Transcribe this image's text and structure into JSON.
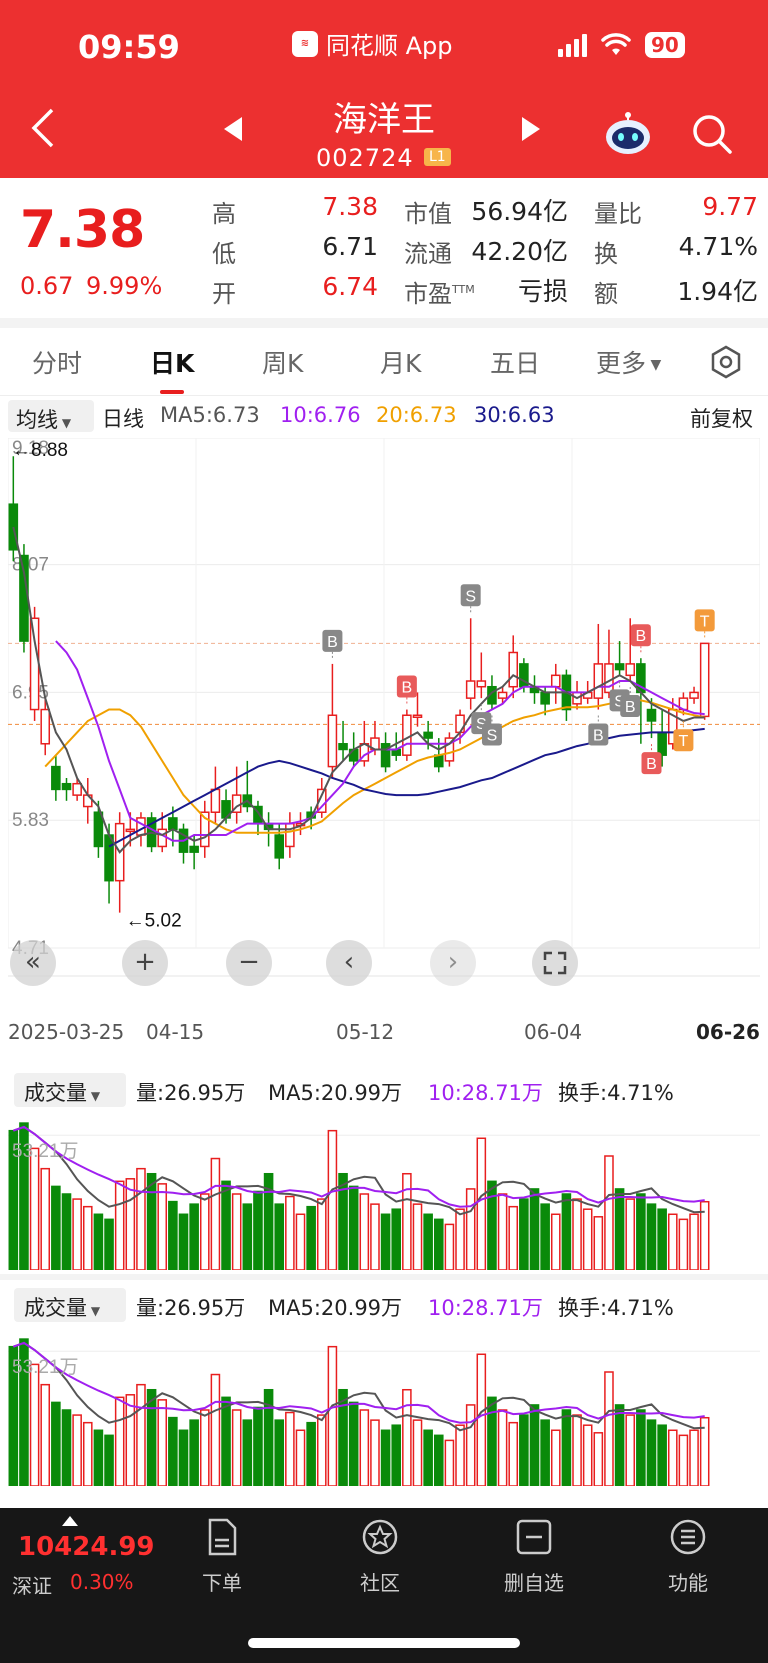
{
  "status": {
    "time": "09:59",
    "app": "同花顺 App",
    "battery": "90"
  },
  "header": {
    "name": "海洋王",
    "code": "002724",
    "badge": "L1",
    "color": "#ec3030"
  },
  "quote": {
    "price": "7.38",
    "change": "0.67",
    "change_pct": "9.99%",
    "items": [
      {
        "label": "高",
        "value": "7.38",
        "color": "#e81e1e"
      },
      {
        "label": "低",
        "value": "6.71",
        "color": "#222222"
      },
      {
        "label": "开",
        "value": "6.74",
        "color": "#e81e1e"
      },
      {
        "label": "市值",
        "value": "56.94亿",
        "color": "#222222"
      },
      {
        "label": "流通",
        "value": "42.20亿",
        "color": "#222222"
      },
      {
        "label": "市盈",
        "sup": "TTM",
        "value": "亏损",
        "color": "#222222"
      },
      {
        "label": "量比",
        "value": "9.77",
        "color": "#e81e1e"
      },
      {
        "label": "换",
        "value": "4.71%",
        "color": "#222222"
      },
      {
        "label": "额",
        "value": "1.94亿",
        "color": "#222222"
      }
    ]
  },
  "tabs": [
    "分时",
    "日K",
    "周K",
    "月K",
    "五日",
    "更多"
  ],
  "active_tab": 1,
  "ma_row": {
    "btn": "均线",
    "period": "日线",
    "ma5": "MA5:6.73",
    "ma10": "10:6.76",
    "ma20": "20:6.73",
    "ma30": "30:6.63",
    "adjust": "前复权",
    "colors": {
      "ma5": "#555555",
      "ma10": "#a020f0",
      "ma20": "#f0a000",
      "ma30": "#1a1a8c"
    }
  },
  "chart_data": {
    "type": "candlestick",
    "y_ticks": [
      "9.18",
      "8.07",
      "6.95",
      "5.83",
      "4.71"
    ],
    "ylim": [
      4.71,
      9.18
    ],
    "high_label": "←8.88",
    "low_label": "←5.02",
    "ref_lines": [
      7.38,
      6.67
    ],
    "x_ticks": [
      "2025-03-25",
      "04-15",
      "05-12",
      "06-04",
      "06-26"
    ],
    "candles": [
      [
        8.6,
        8.2,
        9.02,
        8.1
      ],
      [
        8.15,
        7.4,
        8.25,
        7.3
      ],
      [
        6.8,
        7.6,
        7.7,
        6.7
      ],
      [
        6.5,
        6.8,
        6.9,
        6.4
      ],
      [
        6.3,
        6.1,
        6.4,
        6.0
      ],
      [
        6.15,
        6.1,
        6.2,
        6.0
      ],
      [
        6.05,
        6.15,
        6.2,
        6.0
      ],
      [
        5.95,
        6.05,
        6.2,
        5.8
      ],
      [
        5.9,
        5.6,
        6.0,
        5.5
      ],
      [
        5.7,
        5.3,
        5.8,
        5.1
      ],
      [
        5.3,
        5.8,
        5.9,
        5.02
      ],
      [
        5.75,
        5.75,
        5.9,
        5.6
      ],
      [
        5.7,
        5.85,
        5.9,
        5.6
      ],
      [
        5.85,
        5.6,
        5.9,
        5.55
      ],
      [
        5.6,
        5.75,
        5.9,
        5.55
      ],
      [
        5.85,
        5.75,
        5.95,
        5.6
      ],
      [
        5.75,
        5.55,
        5.8,
        5.45
      ],
      [
        5.6,
        5.55,
        5.7,
        5.4
      ],
      [
        5.6,
        5.9,
        6.0,
        5.5
      ],
      [
        5.9,
        6.1,
        6.3,
        5.8
      ],
      [
        6.0,
        5.85,
        6.1,
        5.8
      ],
      [
        5.9,
        6.05,
        6.3,
        5.8
      ],
      [
        6.05,
        5.95,
        6.35,
        5.9
      ],
      [
        5.95,
        5.8,
        6.0,
        5.7
      ],
      [
        5.8,
        5.75,
        5.9,
        5.6
      ],
      [
        5.7,
        5.5,
        5.8,
        5.4
      ],
      [
        5.6,
        5.8,
        5.9,
        5.5
      ],
      [
        5.8,
        5.8,
        5.9,
        5.7
      ],
      [
        5.9,
        5.85,
        5.95,
        5.75
      ],
      [
        5.9,
        6.1,
        6.2,
        5.85
      ],
      [
        6.3,
        6.75,
        7.2,
        6.2
      ],
      [
        6.5,
        6.45,
        6.7,
        6.35
      ],
      [
        6.45,
        6.35,
        6.6,
        6.3
      ],
      [
        6.35,
        6.5,
        6.7,
        6.3
      ],
      [
        6.45,
        6.55,
        6.7,
        6.4
      ],
      [
        6.5,
        6.3,
        6.6,
        6.25
      ],
      [
        6.45,
        6.4,
        6.6,
        6.35
      ],
      [
        6.4,
        6.75,
        6.8,
        6.35
      ],
      [
        6.75,
        6.75,
        6.95,
        6.65
      ],
      [
        6.6,
        6.55,
        6.7,
        6.45
      ],
      [
        6.4,
        6.3,
        6.55,
        6.25
      ],
      [
        6.35,
        6.55,
        6.6,
        6.3
      ],
      [
        6.6,
        6.75,
        6.8,
        6.5
      ],
      [
        6.9,
        7.05,
        7.6,
        6.8
      ],
      [
        7.0,
        7.05,
        7.3,
        6.9
      ],
      [
        7.0,
        6.85,
        7.1,
        6.8
      ],
      [
        6.9,
        6.95,
        7.0,
        6.85
      ],
      [
        7.0,
        7.3,
        7.45,
        6.9
      ],
      [
        7.2,
        7.0,
        7.25,
        6.95
      ],
      [
        7.0,
        6.95,
        7.1,
        6.85
      ],
      [
        6.95,
        6.85,
        7.0,
        6.75
      ],
      [
        7.0,
        7.1,
        7.2,
        6.85
      ],
      [
        7.1,
        6.8,
        7.15,
        6.7
      ],
      [
        6.85,
        6.95,
        7.05,
        6.8
      ],
      [
        6.9,
        6.95,
        7.05,
        6.85
      ],
      [
        6.9,
        7.2,
        7.55,
        6.8
      ],
      [
        6.95,
        7.2,
        7.5,
        6.9
      ],
      [
        7.2,
        7.15,
        7.4,
        7.1
      ],
      [
        7.1,
        7.2,
        7.6,
        7.05
      ],
      [
        7.2,
        6.95,
        7.25,
        6.5
      ],
      [
        6.8,
        6.7,
        6.9,
        6.55
      ],
      [
        6.6,
        6.4,
        6.8,
        6.3
      ],
      [
        6.5,
        6.8,
        6.9,
        6.45
      ],
      [
        6.8,
        6.9,
        6.95,
        6.75
      ],
      [
        6.9,
        6.95,
        7.0,
        6.85
      ],
      [
        6.74,
        7.38,
        7.38,
        6.71
      ]
    ],
    "ma5": [
      8.4,
      8.0,
      7.4,
      6.9,
      6.6,
      6.45,
      6.2,
      6.05,
      5.95,
      5.7,
      5.55,
      5.65,
      5.7,
      5.72,
      5.7,
      5.75,
      5.7,
      5.65,
      5.68,
      5.75,
      5.85,
      5.95,
      6.0,
      5.9,
      5.75,
      5.75,
      5.75,
      5.78,
      5.85,
      6.05,
      6.25,
      6.35,
      6.45,
      6.5,
      6.45,
      6.45,
      6.5,
      6.55,
      6.6,
      6.5,
      6.45,
      6.5,
      6.6,
      6.75,
      6.85,
      6.95,
      7.0,
      7.1,
      7.05,
      7.0,
      6.95,
      6.95,
      6.95,
      6.9,
      6.95,
      7.0,
      7.05,
      7.1,
      7.05,
      6.95,
      6.85,
      6.8,
      6.75,
      6.7,
      6.73,
      6.73
    ],
    "ma10": [
      null,
      null,
      null,
      null,
      7.4,
      7.3,
      7.15,
      6.9,
      6.65,
      6.35,
      6.1,
      5.85,
      5.8,
      5.75,
      5.7,
      5.65,
      5.65,
      5.7,
      5.7,
      5.7,
      5.7,
      5.75,
      5.8,
      5.8,
      5.8,
      5.8,
      5.8,
      5.82,
      5.85,
      5.95,
      6.05,
      6.15,
      6.3,
      6.4,
      6.45,
      6.45,
      6.45,
      6.5,
      6.5,
      6.5,
      6.5,
      6.5,
      6.55,
      6.65,
      6.75,
      6.8,
      6.85,
      6.95,
      7.0,
      7.0,
      7.0,
      7.0,
      6.95,
      6.95,
      6.95,
      7.0,
      7.0,
      7.05,
      7.05,
      7.0,
      6.95,
      6.9,
      6.85,
      6.8,
      6.77,
      6.76
    ],
    "ma20": [
      null,
      null,
      null,
      6.3,
      6.4,
      6.5,
      6.6,
      6.7,
      6.75,
      6.8,
      6.8,
      6.75,
      6.65,
      6.5,
      6.35,
      6.2,
      6.05,
      5.95,
      5.85,
      5.8,
      5.75,
      5.72,
      5.72,
      5.72,
      5.72,
      5.72,
      5.73,
      5.75,
      5.78,
      5.82,
      5.9,
      5.98,
      6.05,
      6.1,
      6.15,
      6.2,
      6.25,
      6.3,
      6.35,
      6.38,
      6.4,
      6.42,
      6.45,
      6.5,
      6.55,
      6.6,
      6.65,
      6.7,
      6.73,
      6.75,
      6.78,
      6.8,
      6.82,
      6.82,
      6.82,
      6.83,
      6.85,
      6.87,
      6.88,
      6.88,
      6.86,
      6.83,
      6.8,
      6.77,
      6.75,
      6.73
    ],
    "ma30": [
      null,
      null,
      null,
      null,
      null,
      null,
      null,
      null,
      null,
      5.6,
      5.65,
      5.7,
      5.75,
      5.8,
      5.85,
      5.9,
      5.95,
      6.0,
      6.05,
      6.1,
      6.15,
      6.2,
      6.25,
      6.3,
      6.33,
      6.35,
      6.33,
      6.3,
      6.27,
      6.24,
      6.2,
      6.17,
      6.14,
      6.1,
      6.08,
      6.06,
      6.05,
      6.05,
      6.05,
      6.06,
      6.08,
      6.1,
      6.12,
      6.15,
      6.18,
      6.2,
      6.24,
      6.28,
      6.32,
      6.36,
      6.4,
      6.42,
      6.45,
      6.48,
      6.5,
      6.53,
      6.55,
      6.57,
      6.58,
      6.59,
      6.6,
      6.6,
      6.6,
      6.61,
      6.62,
      6.63
    ],
    "markers": [
      {
        "i": 30,
        "label": "B",
        "color": "#888888",
        "above": true
      },
      {
        "i": 37,
        "label": "B",
        "color": "#e85a5a",
        "above": true
      },
      {
        "i": 43,
        "label": "S",
        "color": "#888888",
        "above": true
      },
      {
        "i": 44,
        "label": "S",
        "color": "#888888",
        "above": false
      },
      {
        "i": 45,
        "label": "S",
        "color": "#888888",
        "above": false
      },
      {
        "i": 55,
        "label": "B",
        "color": "#888888",
        "above": false
      },
      {
        "i": 57,
        "label": "S",
        "color": "#888888",
        "above": false
      },
      {
        "i": 58,
        "label": "B",
        "color": "#888888",
        "above": false
      },
      {
        "i": 59,
        "label": "B",
        "color": "#e85a5a",
        "above": true
      },
      {
        "i": 60,
        "label": "B",
        "color": "#e85a5a",
        "above": false
      },
      {
        "i": 63,
        "label": "T",
        "color": "#f39a3a",
        "above": false
      },
      {
        "i": 65,
        "label": "T",
        "color": "#f39a3a",
        "above": true
      }
    ]
  },
  "volume_panels": [
    {
      "btn": "成交量",
      "vol": "量:26.95万",
      "ma5": "MA5:20.99万",
      "ma10": "10:28.71万",
      "turnover": "换手:4.71%",
      "tick": "53.21万"
    },
    {
      "btn": "成交量",
      "vol": "量:26.95万",
      "ma5": "MA5:20.99万",
      "ma10": "10:28.71万",
      "turnover": "换手:4.71%",
      "tick": "53.21万"
    }
  ],
  "volumes": [
    55,
    58,
    48,
    40,
    33,
    30,
    28,
    25,
    22,
    20,
    35,
    36,
    40,
    38,
    34,
    27,
    22,
    26,
    30,
    44,
    35,
    30,
    26,
    31,
    38,
    26,
    29,
    22,
    25,
    28,
    55,
    38,
    33,
    30,
    26,
    22,
    24,
    38,
    26,
    22,
    20,
    18,
    24,
    32,
    52,
    35,
    30,
    25,
    28,
    32,
    26,
    22,
    30,
    28,
    24,
    21,
    45,
    32,
    28,
    30,
    26,
    24,
    22,
    20,
    22,
    26.95
  ],
  "controls": {
    "zoom_out": "«",
    "plus": "+",
    "minus": "−",
    "left": "‹",
    "right": "›"
  },
  "bottom": {
    "index_value": "10424.99",
    "index_name": "深证",
    "index_pct": "0.30%",
    "nav": [
      "下单",
      "社区",
      "删自选",
      "功能"
    ]
  }
}
